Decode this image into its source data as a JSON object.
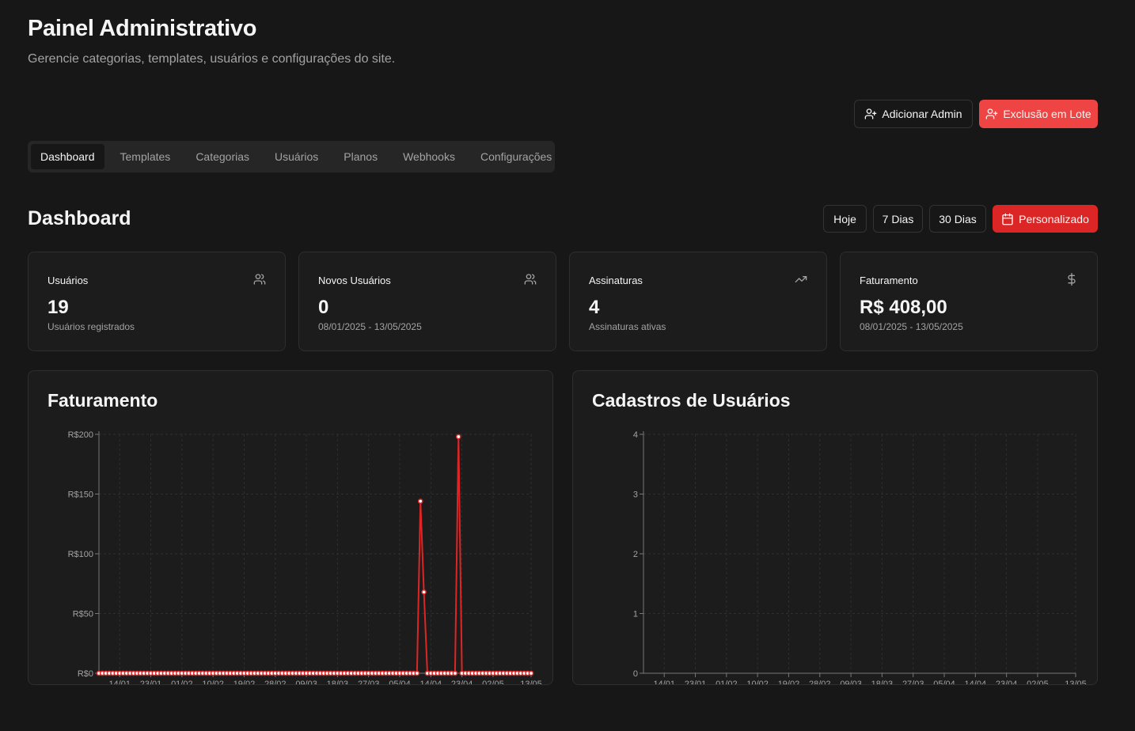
{
  "header": {
    "title": "Painel Administrativo",
    "subtitle": "Gerencie categorias, templates, usuários e configurações do site."
  },
  "actions": {
    "add_admin": "Adicionar Admin",
    "bulk_delete": "Exclusão em Lote"
  },
  "tabs": [
    {
      "label": "Dashboard",
      "active": true
    },
    {
      "label": "Templates",
      "active": false
    },
    {
      "label": "Categorias",
      "active": false
    },
    {
      "label": "Usuários",
      "active": false
    },
    {
      "label": "Planos",
      "active": false
    },
    {
      "label": "Webhooks",
      "active": false
    },
    {
      "label": "Configurações",
      "active": false
    }
  ],
  "dashboard": {
    "title": "Dashboard",
    "ranges": {
      "today": "Hoje",
      "d7": "7 Dias",
      "d30": "30 Dias",
      "custom": "Personalizado"
    }
  },
  "cards": [
    {
      "title": "Usuários",
      "value": "19",
      "desc": "Usuários registrados",
      "icon": "users-icon"
    },
    {
      "title": "Novos Usuários",
      "value": "0",
      "desc": "08/01/2025 - 13/05/2025",
      "icon": "users-icon"
    },
    {
      "title": "Assinaturas",
      "value": "4",
      "desc": "Assinaturas ativas",
      "icon": "trending-up-icon"
    },
    {
      "title": "Faturamento",
      "value": "R$ 408,00",
      "desc": "08/01/2025 - 13/05/2025",
      "icon": "dollar-icon"
    }
  ],
  "colors": {
    "accent": "#dc2626",
    "accent_light": "#ef4444",
    "background": "#171717",
    "card": "#1c1c1c",
    "border": "#2e2e2e"
  },
  "chart_data": [
    {
      "type": "line",
      "title": "Faturamento",
      "x_tick_labels": [
        "14/01",
        "23/01",
        "01/02",
        "10/02",
        "19/02",
        "28/02",
        "09/03",
        "18/03",
        "27/03",
        "05/04",
        "14/04",
        "23/04",
        "02/05",
        "13/05"
      ],
      "y_tick_labels": [
        "R$0",
        "R$50",
        "R$100",
        "R$150",
        "R$200"
      ],
      "ylim": [
        0,
        200
      ],
      "grid": true,
      "color": "#dc2626",
      "series": [
        {
          "points": [
            {
              "x": "08/01",
              "y": 0
            },
            {
              "x": "10/04",
              "y": 0
            },
            {
              "x": "11/04",
              "y": 144
            },
            {
              "x": "12/04",
              "y": 68
            },
            {
              "x": "13/04",
              "y": 0
            },
            {
              "x": "21/04",
              "y": 0
            },
            {
              "x": "22/04",
              "y": 198
            },
            {
              "x": "23/04",
              "y": 0
            },
            {
              "x": "13/05",
              "y": 0
            }
          ]
        }
      ]
    },
    {
      "type": "line",
      "title": "Cadastros de Usuários",
      "x_tick_labels": [
        "14/01",
        "23/01",
        "01/02",
        "10/02",
        "19/02",
        "28/02",
        "09/03",
        "18/03",
        "27/03",
        "05/04",
        "14/04",
        "23/04",
        "02/05",
        "13/05"
      ],
      "y_tick_labels": [
        "0",
        "1",
        "2",
        "3",
        "4"
      ],
      "ylim": [
        0,
        4
      ],
      "grid": true,
      "series": []
    }
  ]
}
